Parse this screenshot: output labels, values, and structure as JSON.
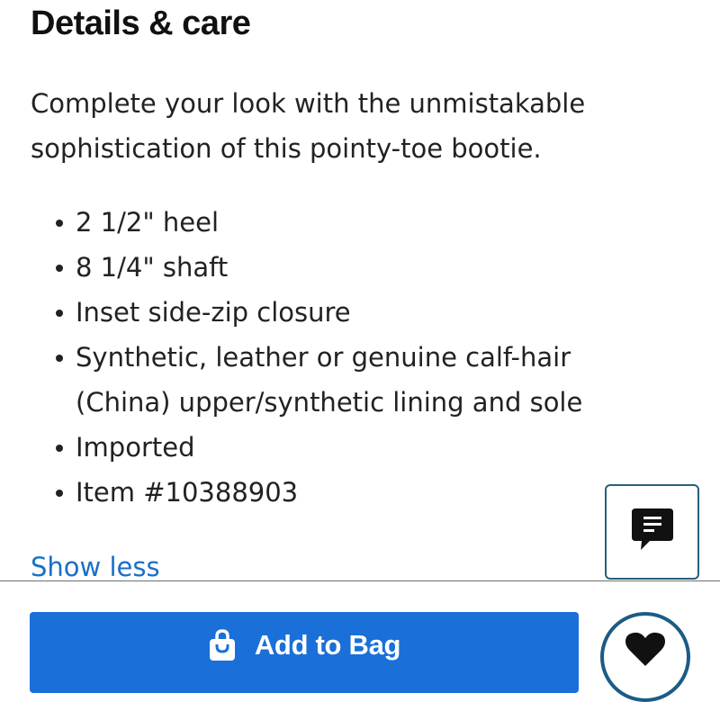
{
  "section": {
    "title": "Details & care",
    "description": "Complete your look with the unmistakable sophistication of this pointy-toe bootie.",
    "bullets": [
      "2 1/2\" heel",
      "8 1/4\" shaft",
      "Inset side-zip closure",
      "Synthetic, leather or genuine calf-hair (China) upper/synthetic lining and sole",
      "Imported",
      "Item #10388903"
    ],
    "show_less_label": "Show less"
  },
  "chat": {
    "icon": "chat-bubble-icon"
  },
  "actions": {
    "add_to_bag_label": "Add to Bag",
    "add_to_bag_icon": "shopping-bag-icon",
    "favorite_icon": "heart-icon"
  },
  "colors": {
    "primary_button": "#1a6fd9",
    "link": "#1a6fc8",
    "chat_border": "#27607d",
    "favorite_border": "#1b5c85",
    "text": "#222222"
  }
}
